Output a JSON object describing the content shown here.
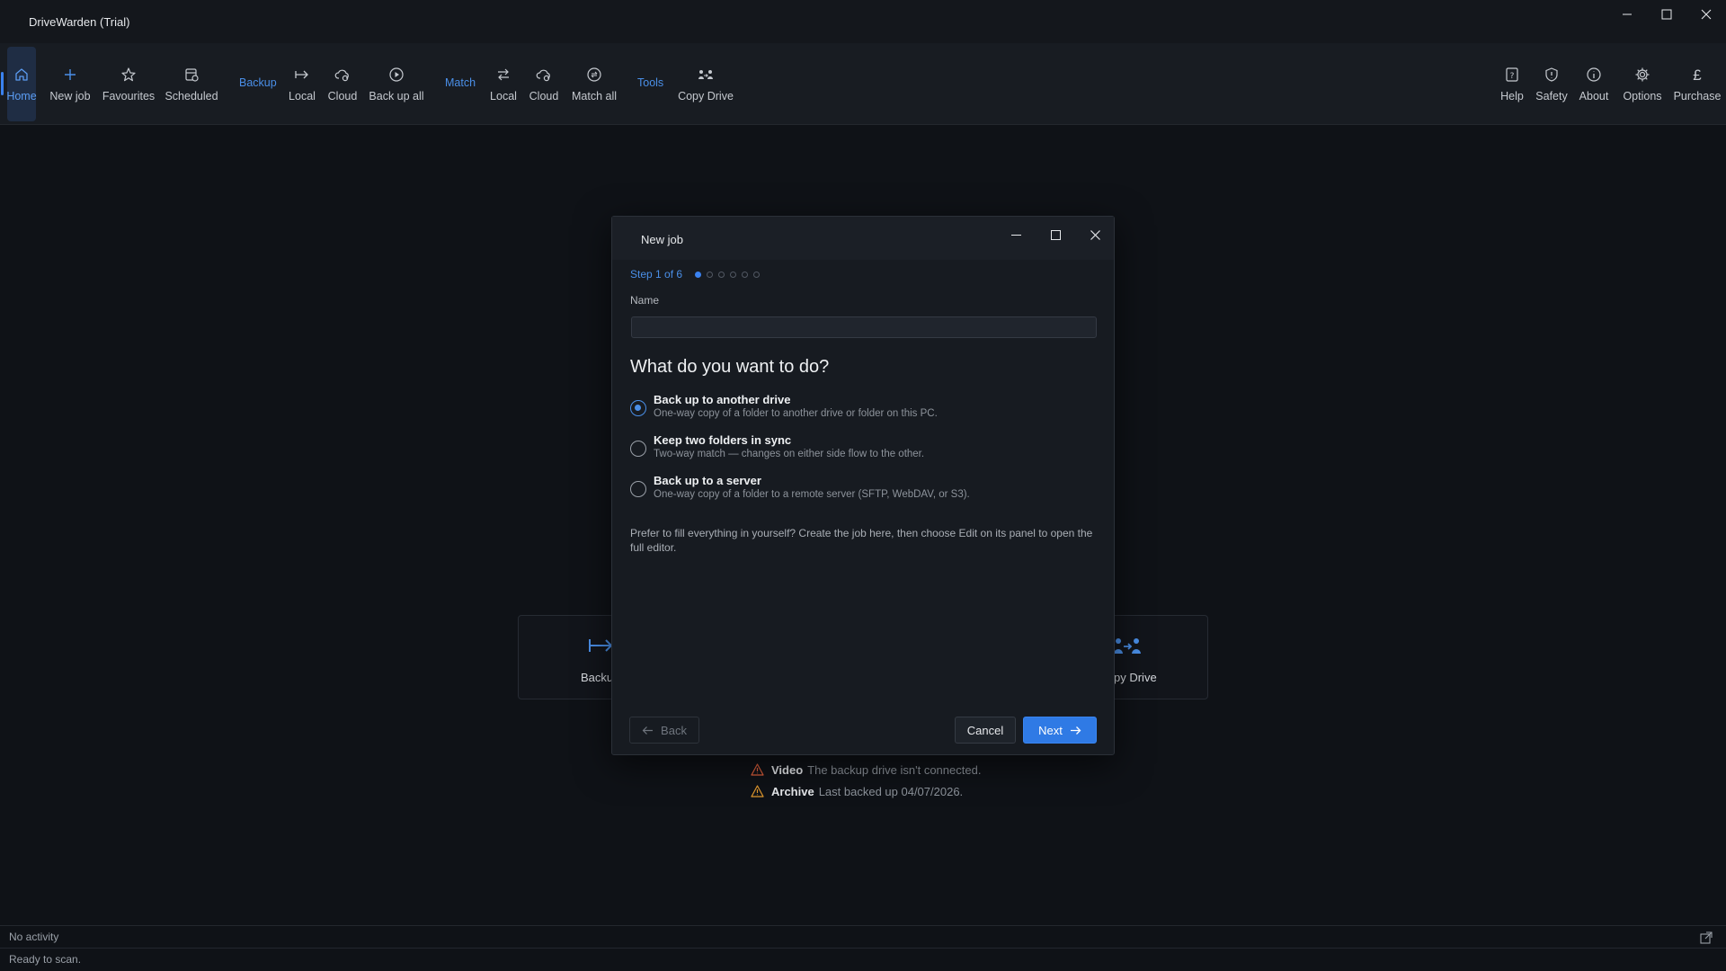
{
  "app": {
    "title": "DriveWarden (Trial)"
  },
  "toolbar": {
    "home": "Home",
    "new_job": "New job",
    "favourites": "Favourites",
    "scheduled": "Scheduled",
    "backup_section": "Backup",
    "backup_local": "Local",
    "backup_cloud": "Cloud",
    "backup_all": "Back up all",
    "match_section": "Match",
    "match_local": "Local",
    "match_cloud": "Cloud",
    "match_all": "Match all",
    "tools_section": "Tools",
    "copy_drive": "Copy Drive",
    "help": "Help",
    "safety": "Safety",
    "about": "About",
    "options": "Options",
    "purchase": "Purchase",
    "purchase_symbol": "£"
  },
  "background": {
    "card_left_label": "Backu",
    "card_right_label": "py Drive",
    "alerts": [
      {
        "name": "Video",
        "message": "The backup drive isn't connected."
      },
      {
        "name": "Archive",
        "message": "Last backed up 04/07/2026."
      }
    ]
  },
  "dialog": {
    "title": "New job",
    "step_text": "Step 1 of 6",
    "total_steps": 6,
    "current_step": 1,
    "name_label": "Name",
    "name_value": "",
    "question": "What do you want to do?",
    "options": [
      {
        "title": "Back up to another drive",
        "description": "One-way copy of a folder to another drive or folder on this PC.",
        "selected": true
      },
      {
        "title": "Keep two folders in sync",
        "description": "Two-way match — changes on either side flow to the other.",
        "selected": false
      },
      {
        "title": "Back up to a server",
        "description": "One-way copy of a folder to a remote server (SFTP, WebDAV, or S3).",
        "selected": false
      }
    ],
    "hint": "Prefer to fill everything in yourself? Create the job here, then choose Edit on its panel to open the full editor.",
    "back_label": "Back",
    "cancel_label": "Cancel",
    "next_label": "Next"
  },
  "status": {
    "activity": "No activity",
    "message": "Ready to scan."
  },
  "colors": {
    "accent": "#3a82f0",
    "accent_text": "#4a8fe8",
    "warning": "#e0603c",
    "background": "#0f1217"
  }
}
